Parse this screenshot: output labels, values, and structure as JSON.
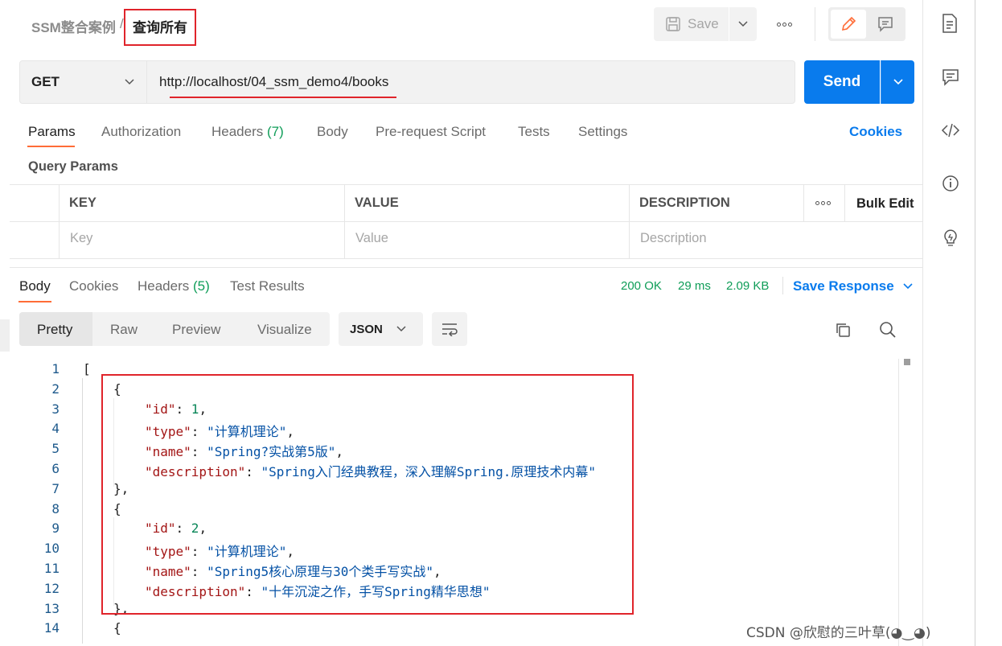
{
  "header": {
    "collection": "SSM整合案例",
    "separator": "/",
    "request_name": "查询所有",
    "save_label": "Save"
  },
  "request": {
    "method": "GET",
    "url": "http://localhost/04_ssm_demo4/books",
    "send_label": "Send"
  },
  "request_tabs": [
    {
      "label": "Params"
    },
    {
      "label": "Authorization"
    },
    {
      "label": "Headers",
      "count": "(7)"
    },
    {
      "label": "Body"
    },
    {
      "label": "Pre-request Script"
    },
    {
      "label": "Tests"
    },
    {
      "label": "Settings"
    }
  ],
  "cookies_label": "Cookies",
  "query_params": {
    "title": "Query Params",
    "columns": [
      "KEY",
      "VALUE",
      "DESCRIPTION"
    ],
    "bulk_edit": "Bulk Edit",
    "placeholders": [
      "Key",
      "Value",
      "Description"
    ]
  },
  "response": {
    "tabs": [
      {
        "label": "Body"
      },
      {
        "label": "Cookies"
      },
      {
        "label": "Headers",
        "count": "(5)"
      },
      {
        "label": "Test Results"
      }
    ],
    "status": "200 OK",
    "time": "29 ms",
    "size": "2.09 KB",
    "save_response": "Save Response",
    "formats": [
      "Pretty",
      "Raw",
      "Preview",
      "Visualize"
    ],
    "language": "JSON"
  },
  "code_lines": [
    {
      "no": "1",
      "indent": 0,
      "text": "["
    },
    {
      "no": "2",
      "indent": 1,
      "text": "{"
    },
    {
      "no": "3",
      "indent": 2,
      "key": "\"id\"",
      "num": "1",
      "tail": ","
    },
    {
      "no": "4",
      "indent": 2,
      "key": "\"type\"",
      "str": "\"计算机理论\"",
      "tail": ","
    },
    {
      "no": "5",
      "indent": 2,
      "key": "\"name\"",
      "str": "\"Spring?实战第5版\"",
      "tail": ","
    },
    {
      "no": "6",
      "indent": 2,
      "key": "\"description\"",
      "str": "\"Spring入门经典教程，深入理解Spring.原理技术内幕\"",
      "tail": ""
    },
    {
      "no": "7",
      "indent": 1,
      "text": "},"
    },
    {
      "no": "8",
      "indent": 1,
      "text": "{"
    },
    {
      "no": "9",
      "indent": 2,
      "key": "\"id\"",
      "num": "2",
      "tail": ","
    },
    {
      "no": "10",
      "indent": 2,
      "key": "\"type\"",
      "str": "\"计算机理论\"",
      "tail": ","
    },
    {
      "no": "11",
      "indent": 2,
      "key": "\"name\"",
      "str": "\"Spring5核心原理与30个类手写实战\"",
      "tail": ","
    },
    {
      "no": "12",
      "indent": 2,
      "key": "\"description\"",
      "str": "\"十年沉淀之作，手写Spring精华思想\"",
      "tail": ""
    },
    {
      "no": "13",
      "indent": 1,
      "text": "},"
    },
    {
      "no": "14",
      "indent": 1,
      "text": "{"
    }
  ],
  "watermark": "CSDN @欣慰的三叶草(◕‿◕)",
  "colors": {
    "accent": "#097bed",
    "tab_underline": "#ff6c37",
    "status_ok": "#0f9d58",
    "highlight": "#e0242b"
  }
}
